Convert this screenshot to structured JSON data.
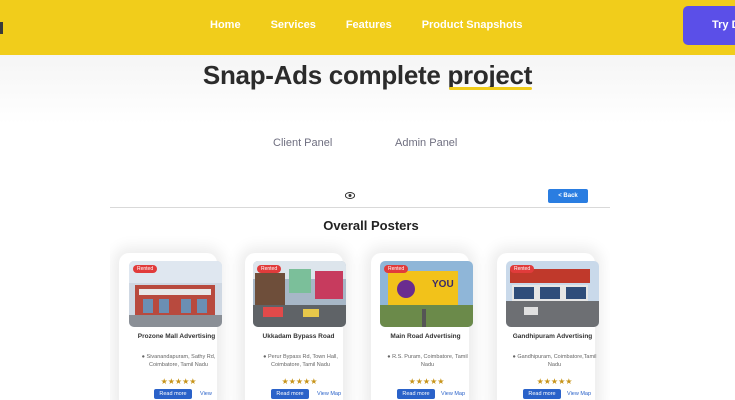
{
  "header": {
    "nav": [
      "Home",
      "Services",
      "Features",
      "Product Snapshots"
    ],
    "cta_label": "Try D"
  },
  "hero": {
    "title_main": "Snap-Ads complete ",
    "title_highlight": "project",
    "tabs": [
      "Client Panel",
      "Admin Panel"
    ]
  },
  "panel": {
    "back_label": "< Back",
    "section_title": "Overall Posters",
    "cards": [
      {
        "badge": "Rented",
        "name": "Prozone Mall Advertising",
        "address": "Sivanandapuram, Sathy Rd, Coimbatore, Tamil Nadu",
        "stars": "★★★★★",
        "read_more": "Read more",
        "view_map": "View Map",
        "image_icon": "mall-image"
      },
      {
        "badge": "Rented",
        "name": "Ukkadam Bypass Road",
        "address": "Perur Bypass Rd, Town Hall, Coimbatore, Tamil Nadu",
        "stars": "★★★★★",
        "read_more": "Read more",
        "view_map": "View Map",
        "image_icon": "road-image"
      },
      {
        "badge": "Rented",
        "name": "Main Road Advertising",
        "address": "R.S. Puram, Coimbatore, Tamil Nadu",
        "stars": "★★★★★",
        "read_more": "Read more",
        "view_map": "View Map",
        "image_icon": "billboard-image",
        "billboard_text": "YOU"
      },
      {
        "badge": "Rented",
        "name": "Gandhipuram Advertising",
        "address": "Gandhipuram, Coimbatore,Tamil Nadu",
        "stars": "★★★★★",
        "read_more": "Read more",
        "view_map": "View Map",
        "image_icon": "street-image"
      }
    ]
  },
  "colors": {
    "brand_yellow": "#f1cd1b",
    "cta_purple": "#5b4fe8",
    "button_blue": "#2a62c9",
    "badge_red": "#e13b3b"
  }
}
